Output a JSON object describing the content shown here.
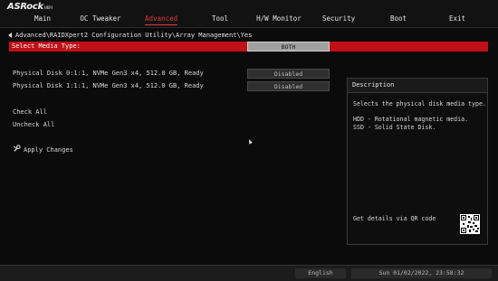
{
  "header": {
    "logo": "ASRock",
    "logo_sub": "UEFI",
    "menu": [
      "Main",
      "OC Tweaker",
      "Advanced",
      "Tool",
      "H/W Monitor",
      "Security",
      "Boot",
      "Exit"
    ],
    "active_tab": "Advanced"
  },
  "breadcrumb": "Advanced\\RAIDXpert2 Configuration Utility\\Array Management\\Yes",
  "media_type": {
    "label": "Select Media Type:",
    "value": "BOTH"
  },
  "disks": [
    {
      "label": "Physical Disk 0:1:1, NVMe Gen3 x4, 512.0 GB, Ready",
      "state": "Disabled"
    },
    {
      "label": "Physical Disk 1:1:1, NVMe Gen3 x4, 512.0 GB, Ready",
      "state": "Disabled"
    }
  ],
  "actions": {
    "check_all": "Check All",
    "uncheck_all": "Uncheck All",
    "apply": "Apply Changes"
  },
  "description": {
    "title": "Description",
    "text": "Selects the physical disk media type.",
    "hdd": "HDD - Rotational magnetic media.",
    "ssd": "SSD - Solid State Disk.",
    "qr_text": "Get details via QR code"
  },
  "footer": {
    "language": "English",
    "datetime": "Sun 01/02/2022, 23:58:32"
  },
  "colors": {
    "accent_red": "#c01018",
    "active_tab": "#e03a3a",
    "background": "#0b0b0b"
  }
}
